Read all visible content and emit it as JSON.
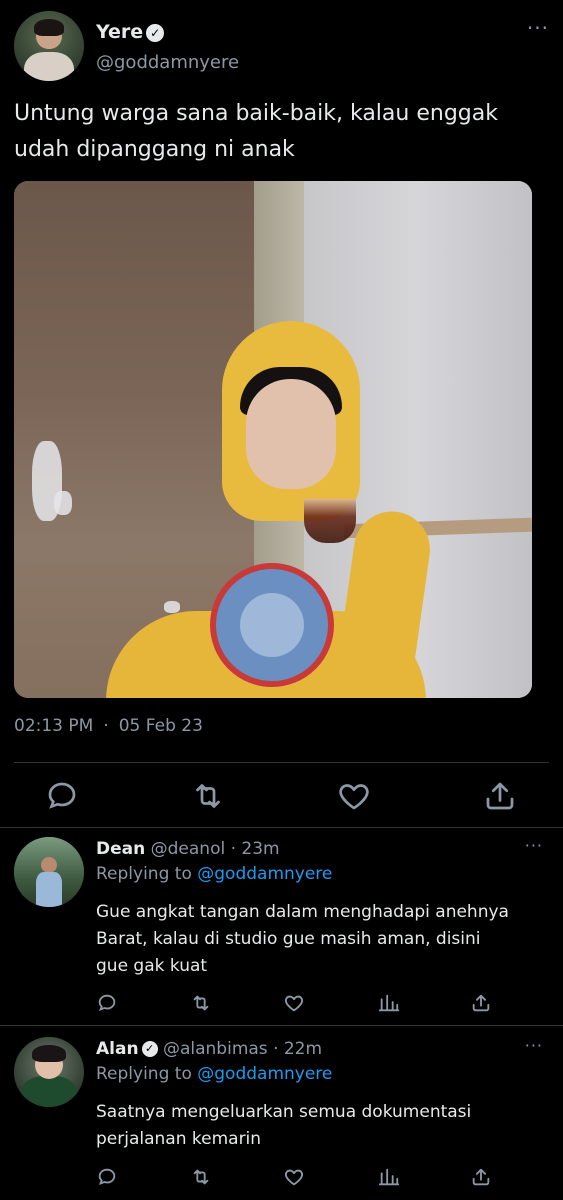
{
  "main_tweet": {
    "display_name": "Yere",
    "handle": "@goddamnyere",
    "text": "Untung warga sana baik-baik, kalau enggak udah dipanggang ni anak",
    "time": "02:13 PM",
    "date": "05 Feb 23",
    "more": "···"
  },
  "replies": [
    {
      "display_name": "Dean",
      "handle": "@deanol",
      "time": "· 23m",
      "replying_label": "Replying to",
      "replying_to": "@goddamnyere",
      "text": "Gue angkat tangan dalam menghadapi anehnya Barat, kalau di studio gue masih aman, disini gue gak kuat",
      "verified": false,
      "more": "···"
    },
    {
      "display_name": "Alan",
      "handle": "@alanbimas",
      "time": "· 22m",
      "replying_label": "Replying to",
      "replying_to": "@goddamnyere",
      "text": "Saatnya mengeluarkan semua dokumentasi perjalanan kemarin",
      "verified": true,
      "more": "···"
    }
  ],
  "icons": {
    "reply": "reply-icon",
    "retweet": "retweet-icon",
    "like": "heart-icon",
    "views": "views-icon",
    "share": "share-icon"
  },
  "colors": {
    "background": "#000000",
    "text": "#e7e9ea",
    "secondary": "#8b98a5",
    "link": "#1d9bf0",
    "divider": "#2f3336"
  }
}
